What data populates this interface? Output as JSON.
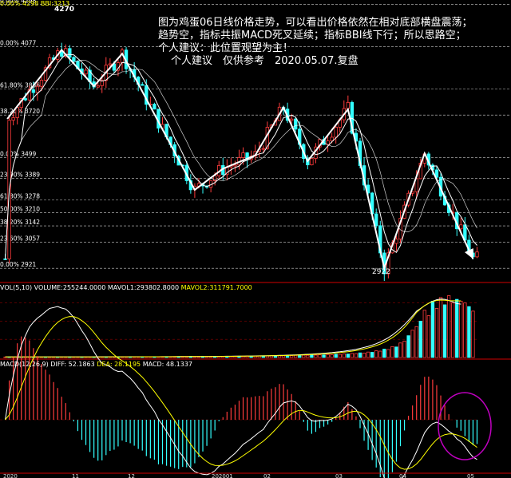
{
  "chart_data": [
    {
      "type": "candlestick",
      "title": "",
      "fib_levels": [
        {
          "label": "0.00% 4298",
          "value": 4298
        },
        {
          "label": "0.00% 4077",
          "value": 4077
        },
        {
          "label": "61.80% 3856",
          "value": 3856
        },
        {
          "label": "38.20% 3720",
          "value": 3720
        },
        {
          "label": "0.00% 3499",
          "value": 3499
        },
        {
          "label": "23.90% 3389",
          "value": 3389
        },
        {
          "label": "61.80% 3278",
          "value": 3278
        },
        {
          "label": "50.00% 3210",
          "value": 3210
        },
        {
          "label": "38.20% 3142",
          "value": 3142
        },
        {
          "label": "23.60% 3057",
          "value": 3057
        },
        {
          "label": "0.00% 2921",
          "value": 2921
        }
      ],
      "ylim": [
        2880,
        4320
      ],
      "annotations": {
        "high_label": "4270",
        "low_label": "2922",
        "top_left_label": "0.00% 4298 BBI:3213",
        "text_lines": [
          "图为鸡蛋06日线价格走势，可以看出价格依然在相对底部横盘震荡；",
          "趋势空，指标共振MACD死叉延续；指标BBI线下行；所以思路空；",
          "个人建议：此位置观望为主！",
          "个人建议　仅供参考　2020.05.07.复盘"
        ]
      },
      "zigzag_points": [
        [
          0.5,
          3700
        ],
        [
          14,
          4060
        ],
        [
          22,
          3870
        ],
        [
          29,
          4040
        ],
        [
          47,
          3330
        ],
        [
          54,
          3440
        ],
        [
          62,
          3510
        ],
        [
          69,
          3760
        ],
        [
          75,
          3480
        ],
        [
          85,
          3750
        ],
        [
          94,
          2922
        ],
        [
          104,
          3520
        ],
        [
          116,
          2970
        ]
      ]
    },
    {
      "type": "bar",
      "title": "VOL(5,10)",
      "header": "VOL(5,10) VOLUME:255244.0000 MAVOL1:293802.8000",
      "mavol2_text": "MAVOL2:311791.7000",
      "series": [
        {
          "name": "VOLUME",
          "values": [
            2500,
            2500,
            2600,
            2500,
            2800,
            2600,
            2700,
            2600,
            2900,
            2800,
            3000,
            2900,
            3100,
            3000,
            3200,
            3100,
            3300,
            3200,
            3400,
            3300,
            3500,
            3400,
            3600,
            3500,
            3800,
            3600,
            3900,
            3700,
            4000,
            3800,
            4100,
            3900,
            4200,
            4000,
            4400,
            4100,
            4500,
            4200,
            4600,
            4400,
            4800,
            4600,
            5000,
            4800,
            5200,
            5000,
            5400,
            5200,
            5600,
            5400,
            5900,
            5700,
            6200,
            6000,
            6500,
            6300,
            6900,
            6700,
            7300,
            7100,
            7800,
            7500,
            8300,
            8000,
            8900,
            8600,
            9500,
            9200,
            10200,
            9800,
            11000,
            10500,
            11900,
            11300,
            12900,
            12200,
            14000,
            13200,
            15200,
            14400,
            16600,
            15800,
            18200,
            17400,
            20000,
            19200,
            22500,
            21500,
            25500,
            24500,
            30000,
            28500,
            37000,
            35000,
            46000,
            44000,
            60000,
            58000,
            80000,
            90000,
            120000,
            150000,
            170000,
            200000,
            260000,
            230000,
            310000,
            270000,
            330000,
            290000,
            340000,
            300000,
            320000,
            310000,
            300000,
            280000,
            255244
          ]
        },
        {
          "name": "MAVOL1",
          "values": [
            3000,
            3000,
            3000,
            3000,
            3100,
            3100,
            3100,
            3200,
            3200,
            3200,
            3300,
            3300,
            3300,
            3400,
            3400,
            3400,
            3500,
            3500,
            3500,
            3600,
            3600,
            3700,
            3700,
            3800,
            3800,
            3900,
            3900,
            4000,
            4000,
            4100,
            4100,
            4200,
            4200,
            4300,
            4400,
            4400,
            4500,
            4600,
            4600,
            4700,
            4800,
            4900,
            5000,
            5100,
            5200,
            5300,
            5400,
            5500,
            5600,
            5800,
            5900,
            6100,
            6300,
            6500,
            6700,
            6900,
            7100,
            7400,
            7600,
            7900,
            8200,
            8500,
            8900,
            9300,
            9700,
            10100,
            10600,
            11100,
            11700,
            12300,
            13000,
            13800,
            14600,
            15500,
            16500,
            17600,
            18800,
            20100,
            21600,
            23200,
            25000,
            27000,
            29300,
            31800,
            34600,
            37700,
            41300,
            45300,
            49900,
            55100,
            61100,
            68000,
            76100,
            85500,
            96500,
            109000,
            124000,
            141000,
            160000,
            181000,
            204000,
            229000,
            255000,
            270000,
            285000,
            298000,
            310000,
            318000,
            322000,
            320000,
            314000,
            306000,
            297000,
            293802
          ]
        },
        {
          "name": "MAVOL2",
          "values": [
            3000,
            3000,
            3000,
            3000,
            3000,
            3000,
            3100,
            3100,
            3100,
            3100,
            3200,
            3200,
            3200,
            3300,
            3300,
            3300,
            3400,
            3400,
            3400,
            3500,
            3500,
            3500,
            3600,
            3600,
            3700,
            3700,
            3800,
            3800,
            3900,
            3900,
            4000,
            4000,
            4100,
            4100,
            4200,
            4200,
            4300,
            4400,
            4400,
            4500,
            4600,
            4600,
            4700,
            4800,
            4900,
            5000,
            5100,
            5200,
            5300,
            5400,
            5500,
            5700,
            5800,
            6000,
            6200,
            6400,
            6600,
            6800,
            7000,
            7300,
            7500,
            7800,
            8100,
            8400,
            8800,
            9200,
            9600,
            10000,
            10500,
            11000,
            11600,
            12200,
            12900,
            13600,
            14400,
            15300,
            16300,
            17400,
            18600,
            19900,
            21400,
            23100,
            25000,
            27100,
            29500,
            32200,
            35300,
            38800,
            42800,
            47400,
            52700,
            58800,
            65900,
            74200,
            84000,
            95500,
            109000,
            125000,
            144000,
            166000,
            191000,
            219000,
            248000,
            268000,
            286000,
            299000,
            308000,
            314000,
            316000,
            315000,
            313000,
            312000,
            311800,
            311791
          ]
        }
      ],
      "ylim": [
        0,
        360000
      ]
    },
    {
      "type": "macd",
      "title": "MACD(12,26,9)",
      "header": "MACD(12,26,9) DIFF: 52.1863",
      "dea_text": "DEA: 28.1195",
      "macd_text": "MACD: 48.1337",
      "ylim": [
        -120,
        120
      ]
    }
  ],
  "x_tick_labels": [
    "2020",
    "11",
    "12",
    "202001",
    "02",
    "03",
    "04",
    "05"
  ],
  "colors": {
    "up": "#ff3c3c",
    "down": "#33ffff",
    "ma": "#ffffff",
    "ma2": "#ffff00",
    "fib": "#ffffff",
    "circle": "#c000c0",
    "mavol2": "#ffff00"
  }
}
